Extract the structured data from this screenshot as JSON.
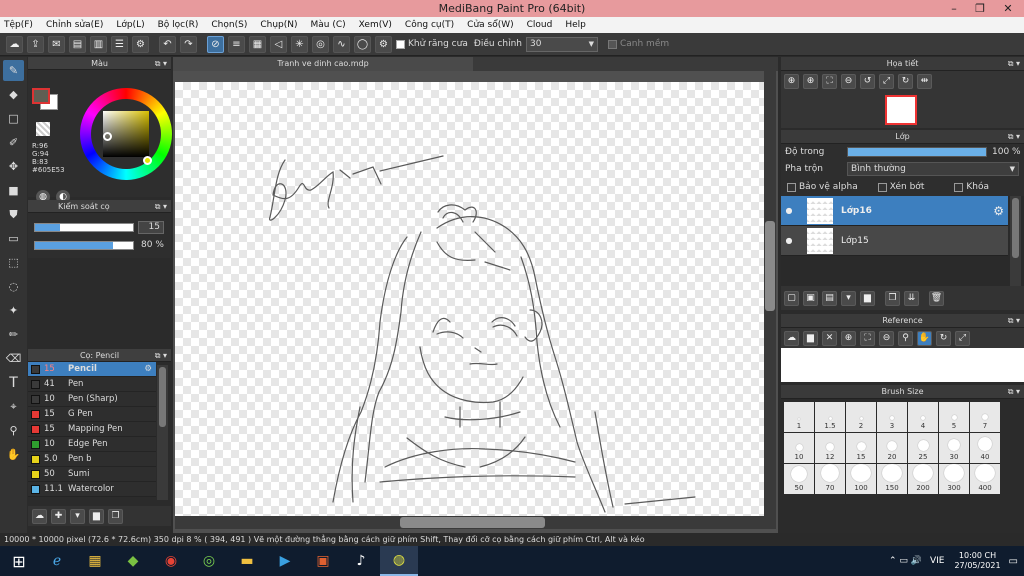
{
  "window": {
    "title": "MediBang Paint Pro (64bit)",
    "min_icon": "minimize-icon",
    "max_icon": "restore-icon",
    "close_icon": "close-icon"
  },
  "menu": [
    "Tệp(F)",
    "Chỉnh sửa(E)",
    "Lớp(L)",
    "Bộ lọc(R)",
    "Chọn(S)",
    "Chụp(N)",
    "Màu (C)",
    "Xem(V)",
    "Công cụ(T)",
    "Cửa sổ(W)",
    "Cloud",
    "Help"
  ],
  "toolbar": {
    "antialias_label": "Khử răng cưa",
    "adjust_label": "Điều chỉnh",
    "adjust_value": "30",
    "smooth_label": "Canh mềm"
  },
  "color_panel": {
    "title": "Màu",
    "r": "R:96",
    "g": "G:94",
    "b": "B:83",
    "hex": "#605E53",
    "fg_color": "#605E53",
    "bg_color": "#ffffff"
  },
  "brush_control": {
    "title": "Kiểm soát cọ",
    "size": "15",
    "opacity": "80 %",
    "size_fill": 0.25,
    "opacity_fill": 0.8
  },
  "brush_list": {
    "title": "Cọ: Pencil",
    "items": [
      {
        "size": "15",
        "name": "Pencil",
        "color": "#3a3a3a",
        "selected": true
      },
      {
        "size": "41",
        "name": "Pen",
        "color": "#3a3a3a"
      },
      {
        "size": "10",
        "name": "Pen (Sharp)",
        "color": "#3a3a3a"
      },
      {
        "size": "15",
        "name": "G Pen",
        "color": "#e53935"
      },
      {
        "size": "15",
        "name": "Mapping Pen",
        "color": "#e53935"
      },
      {
        "size": "10",
        "name": "Edge Pen",
        "color": "#2e9e2e"
      },
      {
        "size": "5.0",
        "name": "Pen b",
        "color": "#e6d21a"
      },
      {
        "size": "50",
        "name": "Sumi",
        "color": "#e6d21a"
      },
      {
        "size": "11.1",
        "name": "Watercolor",
        "color": "#5ab4e6"
      }
    ]
  },
  "document": {
    "tab": "Tranh ve dinh cao.mdp"
  },
  "navigator": {
    "title": "Họa tiết"
  },
  "layers": {
    "title": "Lớp",
    "opacity_label": "Độ trong",
    "opacity_value": "100 %",
    "opacity_fill": 1.0,
    "blend_label": "Pha trộn",
    "blend_value": "Bình thường",
    "protect_alpha": "Bảo vệ alpha",
    "clip": "Xén bớt",
    "lock": "Khóa",
    "items": [
      {
        "name": "Lớp16",
        "selected": true
      },
      {
        "name": "Lớp15",
        "selected": false
      }
    ]
  },
  "reference": {
    "title": "Reference"
  },
  "brush_size": {
    "title": "Brush Size",
    "values": [
      "1",
      "1.5",
      "2",
      "3",
      "4",
      "5",
      "7",
      "10",
      "12",
      "15",
      "20",
      "25",
      "30",
      "40",
      "50",
      "70",
      "100",
      "150",
      "200",
      "300",
      "400"
    ]
  },
  "status": {
    "text": "10000 * 10000 pixel   (72.6 * 72.6cm)   350 dpi   8 %   ( 394, 491 )   Vẽ một đường thẳng bằng cách giữ phím Shift, Thay đổi cỡ cọ bằng cách giữ phím Ctrl, Alt và kéo"
  },
  "taskbar": {
    "lang": "VIE",
    "time": "10:00 CH",
    "date": "27/05/2021"
  }
}
